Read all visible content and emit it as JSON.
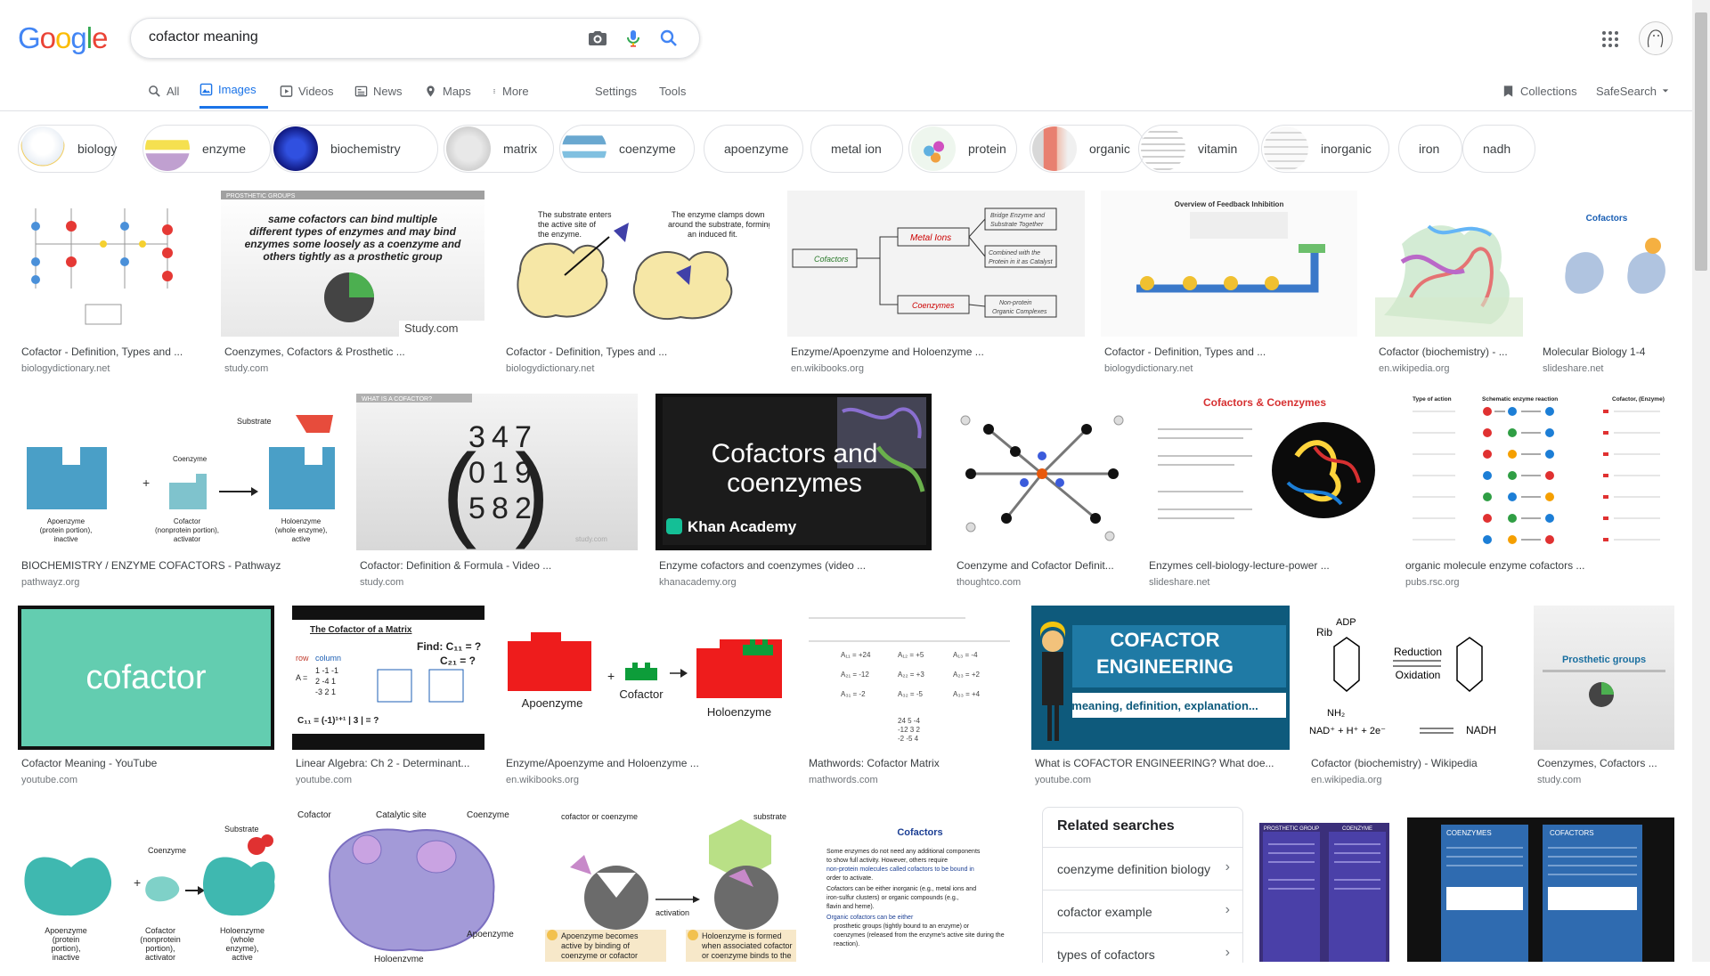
{
  "search": {
    "logo_letters": [
      "G",
      "o",
      "o",
      "g",
      "l",
      "e"
    ],
    "logo_colors": [
      "#4285f4",
      "#ea4335",
      "#fbbc05",
      "#4285f4",
      "#34a853",
      "#ea4335"
    ],
    "query": "cofactor meaning"
  },
  "tabs": [
    {
      "label": "All",
      "icon": "search-icon"
    },
    {
      "label": "Images",
      "icon": "image-icon",
      "active": true
    },
    {
      "label": "Videos",
      "icon": "video-icon"
    },
    {
      "label": "News",
      "icon": "news-icon"
    },
    {
      "label": "Maps",
      "icon": "map-icon"
    },
    {
      "label": "More",
      "icon": "more-vert-icon"
    },
    {
      "label": "Settings"
    },
    {
      "label": "Tools"
    }
  ],
  "right_tools": {
    "collections": "Collections",
    "safesearch": "SafeSearch"
  },
  "chips": [
    "biology",
    "enzyme",
    "biochemistry",
    "matrix",
    "coenzyme",
    "apoenzyme",
    "metal ion",
    "protein",
    "organic",
    "vitamin",
    "inorganic",
    "iron",
    "nadh"
  ],
  "results": {
    "row1": [
      {
        "caption": "Cofactor - Definition, Types and ...",
        "source": "biologydictionary.net"
      },
      {
        "caption": "Coenzymes, Cofactors & Prosthetic ...",
        "source": "study.com",
        "img_text": [
          "PROSTHETIC GROUPS",
          "same cofactors can bind multiple",
          "different types of enzymes and may bind",
          "enzymes some loosely as a coenzyme and",
          "others tightly as a prosthetic group",
          "Study.com"
        ]
      },
      {
        "caption": "Cofactor - Definition, Types and ...",
        "source": "biologydictionary.net",
        "img_text": [
          "The substrate enters",
          "the active site of",
          "the enzyme.",
          "The enzyme clamps down",
          "around the substrate, forming",
          "an induced fit."
        ]
      },
      {
        "caption": "Enzyme/Apoenzyme and Holoenzyme ...",
        "source": "en.wikibooks.org",
        "img_text": [
          "Cofactors",
          "Metal Ions",
          "Coenzymes",
          "Bridge Enzyme and",
          "Substrate Together",
          "Combined with the",
          "Protein in it as Catalyst",
          "Non-protein",
          "Organic Complexes"
        ]
      },
      {
        "caption": "Cofactor - Definition, Types and ...",
        "source": "biologydictionary.net",
        "img_text": [
          "Overview of Feedback Inhibition"
        ]
      },
      {
        "caption": "Cofactor (biochemistry) - ...",
        "source": "en.wikipedia.org"
      },
      {
        "caption": "Molecular Biology 1-4",
        "source": "slideshare.net",
        "img_text": [
          "Cofactors"
        ]
      }
    ],
    "row2": [
      {
        "caption": "BIOCHEMISTRY / ENZYME COFACTORS - Pathwayz",
        "source": "pathwayz.org",
        "img_text": [
          "Substrate",
          "Coenzyme",
          "Apoenzyme",
          "(protein portion),",
          "inactive",
          "Cofactor",
          "(nonprotein portion),",
          "activator",
          "Holoenzyme",
          "(whole enzyme),",
          "active"
        ]
      },
      {
        "caption": "Cofactor: Definition & Formula - Video ...",
        "source": "study.com",
        "img_text": [
          "WHAT IS A COFACTOR?",
          "3",
          "4",
          "7",
          "0",
          "1",
          "9",
          "5",
          "8",
          "2",
          "study.com"
        ]
      },
      {
        "caption": "Enzyme cofactors and coenzymes (video ...",
        "source": "khanacademy.org",
        "img_text": [
          "Cofactors and",
          "coenzymes",
          "Khan Academy"
        ]
      },
      {
        "caption": "Coenzyme and Cofactor Definit...",
        "source": "thoughtco.com"
      },
      {
        "caption": "Enzymes cell-biology-lecture-power ...",
        "source": "slideshare.net",
        "img_text": [
          "Cofactors & Coenzymes"
        ]
      },
      {
        "caption": "organic molecule enzyme cofactors ...",
        "source": "pubs.rsc.org",
        "img_text": [
          "Type of action",
          "Schematic enzyme reaction",
          "Cofactor, (Enzyme)"
        ]
      }
    ],
    "row3": [
      {
        "caption": "Cofactor Meaning - YouTube",
        "source": "youtube.com",
        "img_text": [
          "cofactor"
        ]
      },
      {
        "caption": "Linear Algebra: Ch 2 - Determinant...",
        "source": "youtube.com",
        "img_text": [
          "The Cofactor of a Matrix",
          "Find: C₁₁ = ?",
          "C₂₁ = ?",
          "row",
          "column"
        ]
      },
      {
        "caption": "Enzyme/Apoenzyme and Holoenzyme ...",
        "source": "en.wikibooks.org",
        "img_text": [
          "Apoenzyme",
          "Cofactor",
          "Holoenzyme"
        ]
      },
      {
        "caption": "Mathwords: Cofactor Matrix",
        "source": "mathwords.com"
      },
      {
        "caption": "What is COFACTOR ENGINEERING? What doe...",
        "source": "youtube.com",
        "img_text": [
          "COFACTOR",
          "ENGINEERING",
          "meaning, definition, explanation..."
        ]
      },
      {
        "caption": "Cofactor (biochemistry) - Wikipedia",
        "source": "en.wikipedia.org",
        "img_text": [
          "Rib",
          "ADP",
          "Reduction",
          "Oxidation",
          "NAD⁺ + H⁺ + 2e⁻",
          "NADH",
          "NH₂"
        ]
      },
      {
        "caption": "Coenzymes, Cofactors ...",
        "source": "study.com",
        "img_text": [
          "Prosthetic groups"
        ]
      }
    ],
    "row4": [
      {
        "img_text": [
          "Coenzyme",
          "Substrate",
          "Apoenzyme",
          "(protein",
          "portion),",
          "inactive",
          "Cofactor",
          "(nonprotein",
          "portion),",
          "activator",
          "Holoenzyme",
          "(whole",
          "enzyme),",
          "active"
        ]
      },
      {
        "img_text": [
          "Cofactor",
          "Catalytic site",
          "Coenzyme",
          "Apoenzyme",
          "Holoenzyme"
        ]
      },
      {
        "img_text": [
          "cofactor or coenzyme",
          "substrate",
          "activation",
          "Apoenzyme becomes",
          "active by binding of",
          "coenzyme or cofactor",
          "Holoenzyme is formed",
          "when associated cofactor",
          "or coenzyme binds to the"
        ]
      },
      {
        "img_text": [
          "Cofactors",
          "Some enzymes do not need any additional components",
          "to show full activity. However, others require",
          "non-protein molecules called cofactors to be bound in",
          "order to activate.",
          "Cofactors can be either inorganic (e.g., metal ions and",
          "iron-sulfur clusters) or organic compounds (e.g.,",
          "flavin and heme).",
          "Organic cofactors can be either",
          "prosthetic groups (tightly bound to an enzyme) or",
          "coenzymes (released from the enzyme's active site during the",
          "reaction)."
        ]
      },
      {
        "img_text": [
          "PROSTHETIC GROUP",
          "COENZYME"
        ]
      },
      {
        "img_text": [
          "COENZYMES",
          "COFACTORS"
        ]
      }
    ]
  },
  "related": {
    "title": "Related searches",
    "items": [
      "coenzyme definition biology",
      "cofactor example",
      "types of cofactors"
    ]
  }
}
